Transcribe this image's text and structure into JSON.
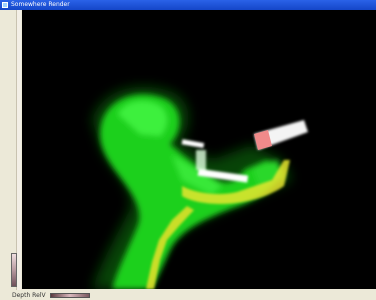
{
  "window": {
    "title": "Somewhere Render",
    "icon": "app-icon"
  },
  "status": {
    "depth_label": "Depth  RelV"
  },
  "scene": {
    "background": "#000000",
    "primary_color": "#22e022",
    "highlight_color": "#ffee44",
    "accent_color": "#ffffff",
    "marker_color": "#f08080"
  }
}
